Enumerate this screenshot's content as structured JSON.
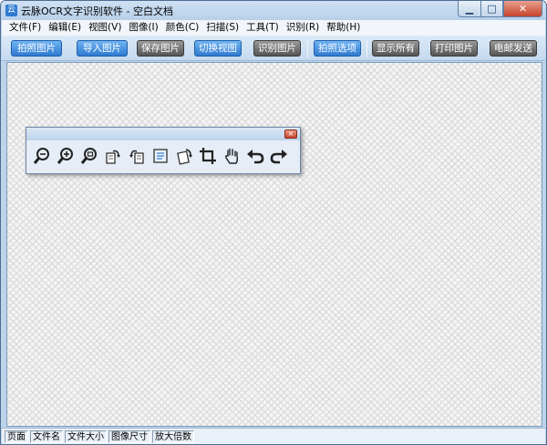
{
  "window": {
    "title": "云脉OCR文字识别软件 - 空白文档",
    "icon": "app-icon",
    "controls": {
      "minimize": "minimize-icon",
      "maximize": "maximize-icon",
      "close": "close-icon"
    }
  },
  "menu": {
    "items": [
      "文件(F)",
      "编辑(E)",
      "视图(V)",
      "图像(I)",
      "颜色(C)",
      "扫描(S)",
      "工具(T)",
      "识别(R)",
      "帮助(H)"
    ]
  },
  "toolbar": {
    "buttons": [
      {
        "label": "拍照图片",
        "style": "blue"
      },
      {
        "label": "导入图片",
        "style": "blue"
      },
      {
        "label": "保存图片",
        "style": "grey"
      },
      {
        "label": "切换视图",
        "style": "blue"
      },
      {
        "label": "识别图片",
        "style": "grey"
      },
      {
        "label": "拍照选项",
        "style": "blue"
      },
      {
        "label": "显示所有",
        "style": "grey"
      },
      {
        "label": "打印图片",
        "style": "grey"
      },
      {
        "label": "电邮发送",
        "style": "grey"
      }
    ]
  },
  "palette": {
    "close_glyph": "×",
    "tools": [
      "zoom-out-icon",
      "zoom-in-icon",
      "zoom-actual-icon",
      "rotate-right-icon",
      "rotate-left-icon",
      "flip-icon",
      "rotate-free-icon",
      "crop-icon",
      "hand-icon",
      "undo-icon",
      "redo-icon"
    ]
  },
  "status": {
    "cells": [
      "页面",
      "文件名",
      "文件大小",
      "图像尺寸",
      "放大倍数"
    ]
  },
  "colors": {
    "toolbar_blue": "#2f7ad1",
    "toolbar_grey": "#555555",
    "titlebar": "#bcd4ec",
    "close_red": "#c4422a"
  }
}
